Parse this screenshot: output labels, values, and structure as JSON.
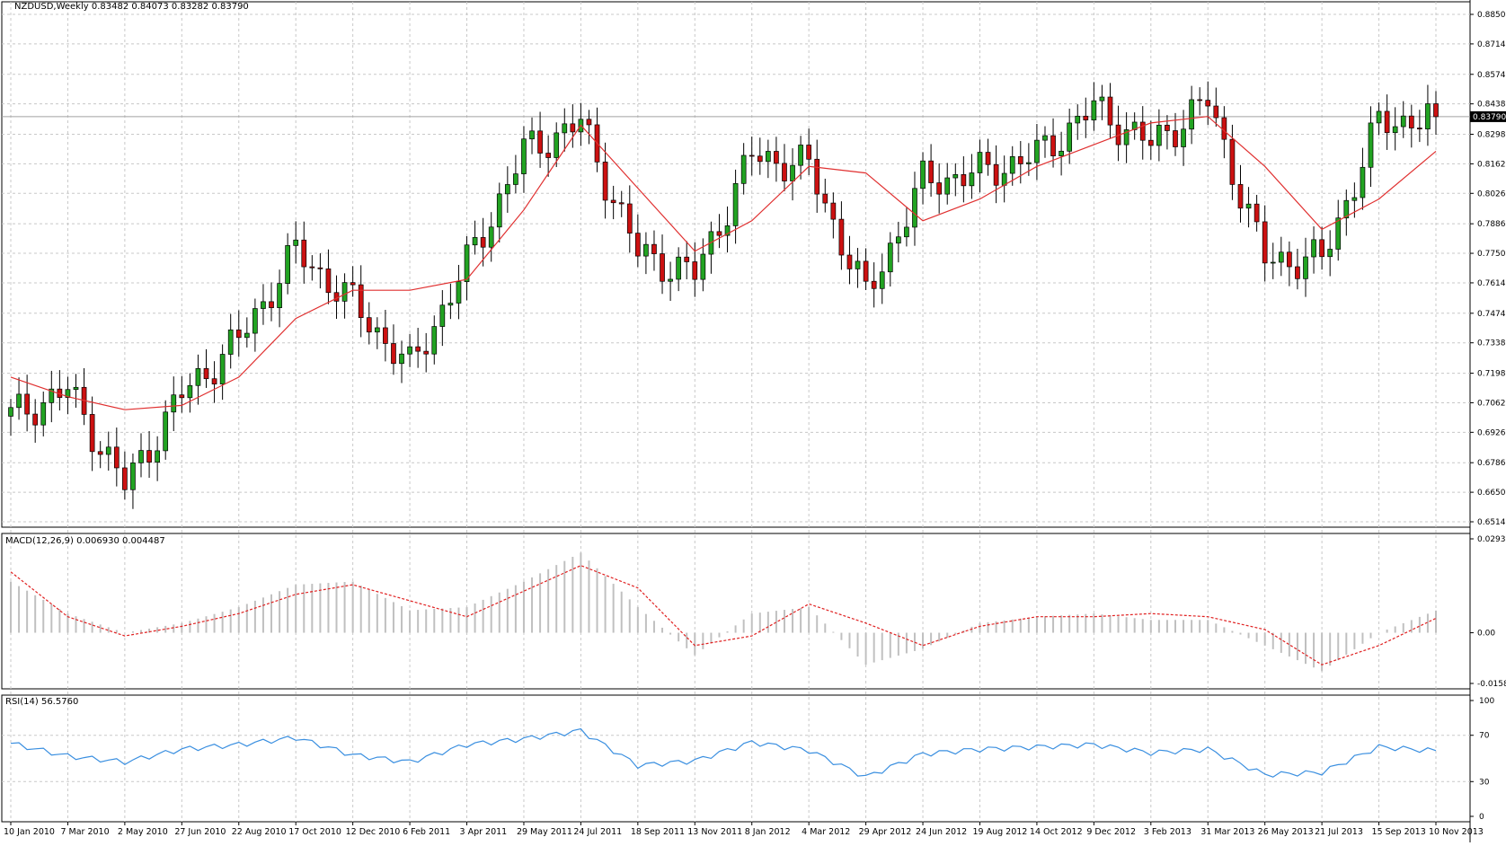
{
  "price_panel": {
    "header": "NZDUSD,Weekly  0.83482 0.84073 0.83282 0.83790",
    "current_price_label": "0.83790",
    "y_ticks": [
      "0.88500",
      "0.87140",
      "0.85740",
      "0.84380",
      "0.82980",
      "0.81620",
      "0.80260",
      "0.78860",
      "0.77500",
      "0.76140",
      "0.74740",
      "0.73380",
      "0.71980",
      "0.70620",
      "0.69260",
      "0.67860",
      "0.66500",
      "0.65140"
    ]
  },
  "macd_panel": {
    "header": "MACD(12,26,9) 0.006930 0.004487",
    "y_ticks": [
      "0.02933",
      "0.00",
      "-0.01584"
    ]
  },
  "rsi_panel": {
    "header": "RSI(14) 56.5760",
    "y_ticks": [
      "100",
      "70",
      "30",
      "0"
    ]
  },
  "x_axis": {
    "labels": [
      "10 Jan 2010",
      "7 Mar 2010",
      "2 May 2010",
      "27 Jun 2010",
      "22 Aug 2010",
      "17 Oct 2010",
      "12 Dec 2010",
      "6 Feb 2011",
      "3 Apr 2011",
      "29 May 2011",
      "24 Jul 2011",
      "18 Sep 2011",
      "13 Nov 2011",
      "8 Jan 2012",
      "4 Mar 2012",
      "29 Apr 2012",
      "24 Jun 2012",
      "19 Aug 2012",
      "14 Oct 2012",
      "9 Dec 2012",
      "3 Feb 2013",
      "31 Mar 2013",
      "26 May 2013",
      "21 Jul 2013",
      "15 Sep 2013",
      "10 Nov 2013"
    ]
  },
  "colors": {
    "bull": "#22a322",
    "bear": "#cc1111",
    "ma": "#e03030",
    "macd_signal": "#e02020",
    "macd_hist": "#c0c0c0",
    "rsi": "#3a8fe0",
    "grid": "#c8c8c8"
  },
  "chart_data": [
    {
      "type": "candlestick",
      "title": "NZDUSD,Weekly",
      "x": [
        "10 Jan 2010",
        "7 Mar 2010",
        "2 May 2010",
        "27 Jun 2010",
        "22 Aug 2010",
        "17 Oct 2010",
        "12 Dec 2010",
        "6 Feb 2011",
        "3 Apr 2011",
        "29 May 2011",
        "24 Jul 2011",
        "18 Sep 2011",
        "13 Nov 2011",
        "8 Jan 2012",
        "4 Mar 2012",
        "29 Apr 2012",
        "24 Jun 2012",
        "19 Aug 2012",
        "14 Oct 2012",
        "9 Dec 2012",
        "3 Feb 2013",
        "31 Mar 2013",
        "26 May 2013",
        "21 Jul 2013",
        "15 Sep 2013",
        "10 Nov 2013"
      ],
      "close": [
        0.7,
        0.712,
        0.668,
        0.71,
        0.735,
        0.776,
        0.752,
        0.722,
        0.77,
        0.822,
        0.835,
        0.775,
        0.765,
        0.82,
        0.815,
        0.755,
        0.808,
        0.812,
        0.82,
        0.842,
        0.825,
        0.845,
        0.772,
        0.772,
        0.835,
        0.8379
      ],
      "ma_close": [
        0.718,
        0.709,
        0.703,
        0.705,
        0.718,
        0.745,
        0.758,
        0.758,
        0.763,
        0.795,
        0.834,
        0.805,
        0.776,
        0.79,
        0.815,
        0.812,
        0.79,
        0.8,
        0.815,
        0.825,
        0.835,
        0.838,
        0.815,
        0.786,
        0.8,
        0.822
      ],
      "last": {
        "open": 0.83482,
        "high": 0.84073,
        "low": 0.83282,
        "close": 0.8379
      },
      "ylim": [
        0.6514,
        0.885
      ]
    },
    {
      "type": "bar",
      "title": "MACD(12,26,9)",
      "series": [
        {
          "name": "MACD",
          "values": [
            0.016,
            0.006,
            0.0,
            0.003,
            0.008,
            0.015,
            0.016,
            0.007,
            0.008,
            0.016,
            0.025,
            0.008,
            -0.007,
            0.006,
            0.008,
            -0.01,
            -0.005,
            0.003,
            0.005,
            0.006,
            0.004,
            0.004,
            -0.004,
            -0.012,
            0.0,
            0.00693
          ]
        },
        {
          "name": "Signal",
          "values": [
            0.019,
            0.005,
            -0.001,
            0.002,
            0.006,
            0.012,
            0.015,
            0.01,
            0.005,
            0.013,
            0.021,
            0.014,
            -0.004,
            -0.001,
            0.009,
            0.003,
            -0.004,
            0.002,
            0.005,
            0.005,
            0.006,
            0.005,
            0.001,
            -0.01,
            -0.004,
            0.004487
          ]
        }
      ],
      "ylim": [
        -0.01584,
        0.02933
      ]
    },
    {
      "type": "line",
      "title": "RSI(14)",
      "series": [
        {
          "name": "RSI",
          "values": [
            63,
            52,
            47,
            58,
            62,
            68,
            53,
            47,
            62,
            67,
            74,
            44,
            48,
            64,
            57,
            34,
            54,
            58,
            60,
            62,
            55,
            58,
            36,
            38,
            60,
            56.576
          ]
        }
      ],
      "ylim": [
        0,
        100
      ]
    }
  ]
}
